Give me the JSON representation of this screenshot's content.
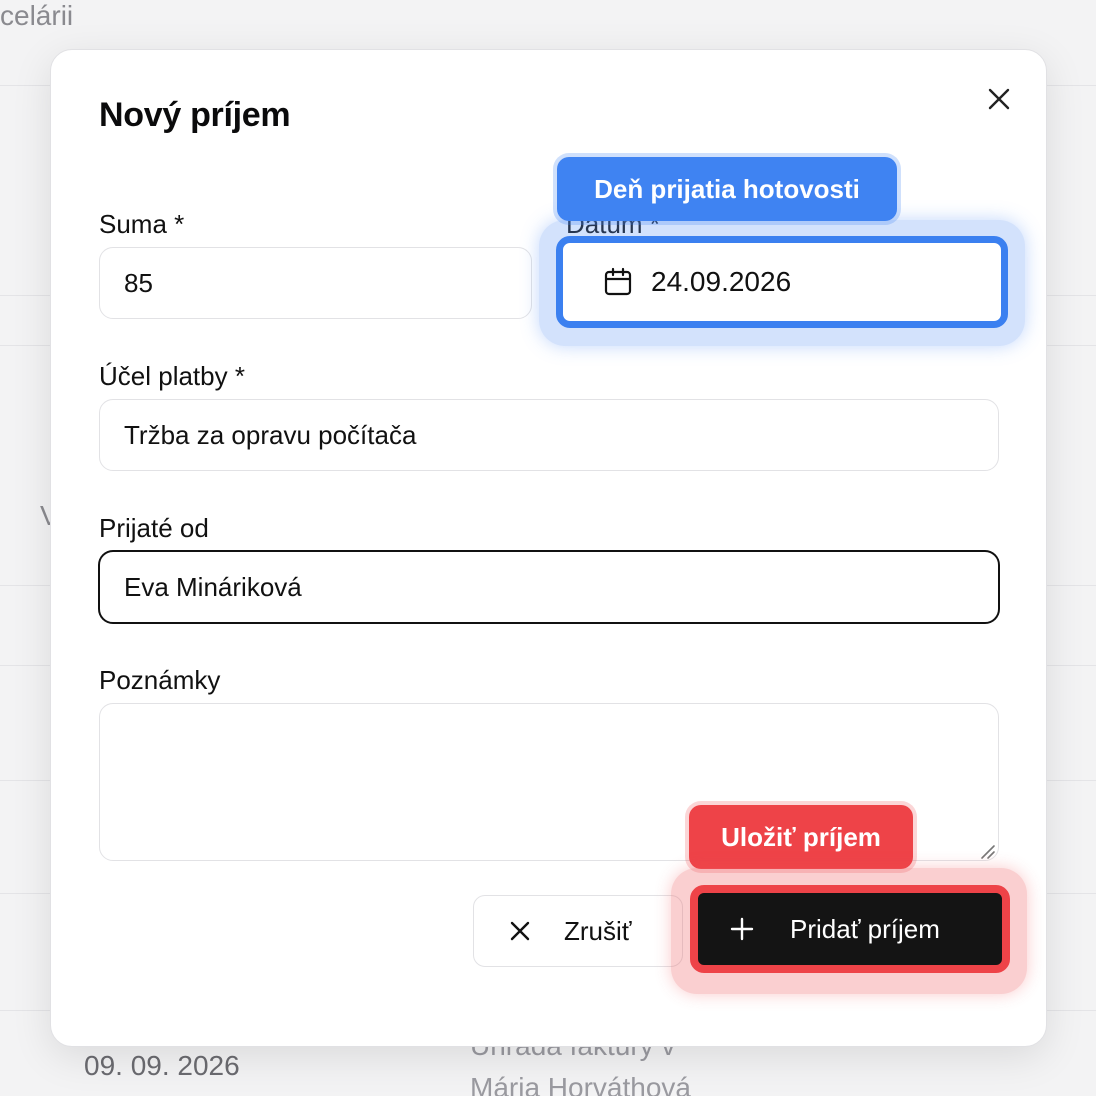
{
  "background": {
    "top_left_text": "celárii",
    "letter_fragment": "V",
    "row_date": "09. 09. 2026",
    "row_desc": "Úhrada faktúry v",
    "row_person": "Mária Horváthová"
  },
  "modal": {
    "title": "Nový príjem",
    "close_icon": "close-icon",
    "fields": {
      "amount": {
        "label": "Suma *",
        "value": "85"
      },
      "date": {
        "label": "Dátum *",
        "value": "24.09.2026",
        "icon": "calendar-icon"
      },
      "purpose": {
        "label": "Účel platby *",
        "value": "Tržba za opravu počítača"
      },
      "received_from": {
        "label": "Prijaté od",
        "value": "Eva Mináriková"
      },
      "notes": {
        "label": "Poznámky",
        "value": ""
      }
    },
    "tooltips": {
      "date_hint": "Deň prijatia hotovosti",
      "save_hint": "Uložiť príjem"
    },
    "buttons": {
      "cancel": {
        "label": "Zrušiť",
        "icon": "x-icon"
      },
      "submit": {
        "label": "Pridať príjem",
        "icon": "plus-icon"
      }
    }
  },
  "colors": {
    "highlight_blue": "#3f83f2",
    "highlight_red": "#ee4348",
    "submit_bg": "#141414"
  }
}
